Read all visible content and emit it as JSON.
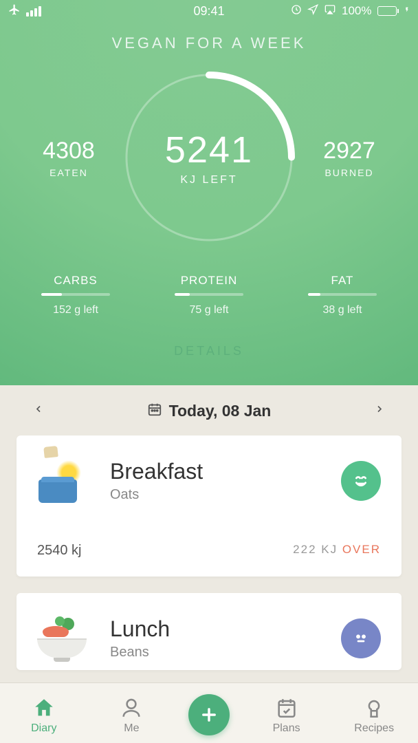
{
  "status": {
    "time": "09:41",
    "battery_pct": "100%"
  },
  "header": {
    "title": "VEGAN FOR A WEEK",
    "eaten_value": "4308",
    "eaten_label": "EATEN",
    "left_value": "5241",
    "left_label": "KJ LEFT",
    "burned_value": "2927",
    "burned_label": "BURNED",
    "macros": {
      "carbs": {
        "name": "CARBS",
        "left": "152 g left",
        "fill_pct": 30
      },
      "protein": {
        "name": "PROTEIN",
        "left": "75 g left",
        "fill_pct": 22
      },
      "fat": {
        "name": "FAT",
        "left": "38 g left",
        "fill_pct": 18
      }
    },
    "details_label": "DETAILS"
  },
  "date": {
    "label": "Today, 08 Jan"
  },
  "meals": [
    {
      "name": "Breakfast",
      "food": "Oats",
      "kj": "2540 kj",
      "over_prefix": "222 KJ ",
      "over_word": "OVER",
      "icon": "toaster",
      "face": "green"
    },
    {
      "name": "Lunch",
      "food": "Beans",
      "kj": "",
      "over_prefix": "",
      "over_word": "",
      "icon": "bowl",
      "face": "blue"
    }
  ],
  "tabs": {
    "diary": "Diary",
    "me": "Me",
    "plans": "Plans",
    "recipes": "Recipes"
  }
}
